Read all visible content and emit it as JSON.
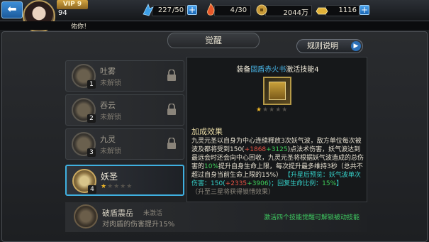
{
  "player": {
    "vip": "VIP 9",
    "level": "94"
  },
  "resources": {
    "stamina": {
      "icon": "stamina-wing-icon",
      "value": "227",
      "max": "/50"
    },
    "energy": {
      "icon": "energy-flame-icon",
      "value": "4",
      "max": "/30"
    },
    "coins": {
      "icon": "coin-icon",
      "value": "2044万"
    },
    "ingots": {
      "icon": "gold-ingot-icon",
      "value": "1116"
    }
  },
  "marquee": "佑你！",
  "panel": {
    "title": "觉醒",
    "rules_label": "规则说明"
  },
  "skills": [
    {
      "name": "吐雾",
      "state": "未解锁",
      "num": "1",
      "locked": true
    },
    {
      "name": "吞云",
      "state": "未解锁",
      "num": "2",
      "locked": true
    },
    {
      "name": "九灵",
      "state": "未解锁",
      "num": "3",
      "locked": true
    },
    {
      "name": "妖圣",
      "state": "",
      "num": "4",
      "locked": false,
      "stars": 1,
      "max_stars": 5
    }
  ],
  "detail": {
    "title_prefix": "装备",
    "title_item": "固盾赤火书",
    "title_suffix": "激活技能4",
    "stars": 1,
    "max_stars": 5,
    "section": "加成效果",
    "desc": {
      "p1": "九灵元圣以自身为中心连续释放3次妖气波，敌方单位每次被波及都将受到150(",
      "v1": "+1868",
      "v2": "+3125",
      "p2": ")点法术伤害，妖气波达到最远会时还会向中心回收，九灵元圣将根据妖气波造成的总伤害的",
      "v3": "10%",
      "p3": "提升自身生命上限，每次提升最多维持3秒（总共不超过自身当前生命上限的15%）",
      "rise_label": "【升星后预览：",
      "p4": "妖气波单次伤害：150(",
      "v4": "+2335",
      "v5": "+3906",
      "p5": ")；回复生命比例：",
      "v6": "15%",
      "p6": "】",
      "hint": "（升至三星将获得锁惜效果）"
    }
  },
  "bottom": {
    "name": "破盾震岳",
    "state": "未激活",
    "desc": "对肉盾的伤害提升15%",
    "hint": "激活四个技能觉醒可解锁被动技能"
  }
}
